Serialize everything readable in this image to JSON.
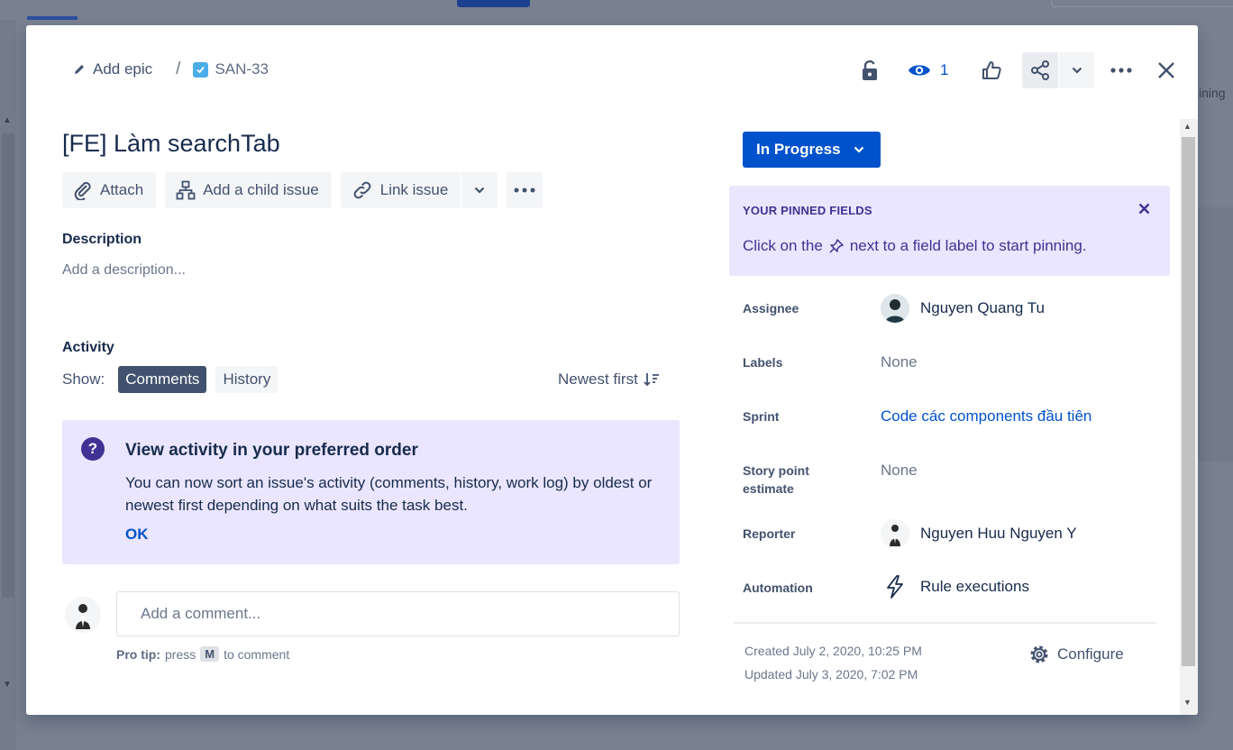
{
  "breadcrumb": {
    "add_epic": "Add epic",
    "separator": "/",
    "issue_key": "SAN-33"
  },
  "toolbar": {
    "watch_count": "1"
  },
  "issue": {
    "title": "[FE] Làm searchTab"
  },
  "actions": {
    "attach": "Attach",
    "add_child": "Add a child issue",
    "link_issue": "Link issue"
  },
  "description": {
    "label": "Description",
    "placeholder": "Add a description..."
  },
  "activity": {
    "label": "Activity",
    "show": "Show:",
    "tabs": [
      "Comments",
      "History"
    ],
    "sort": "Newest first",
    "info": {
      "title": "View activity in your preferred order",
      "body": "You can now sort an issue's activity (comments, history, work log) by oldest or newest first depending on what suits the task best.",
      "ok": "OK"
    },
    "comment_placeholder": "Add a comment...",
    "pro_tip_label": "Pro tip:",
    "pro_tip_pre": "press",
    "pro_tip_key": "M",
    "pro_tip_post": "to comment"
  },
  "status": {
    "label": "In Progress"
  },
  "pinned": {
    "title": "YOUR PINNED FIELDS",
    "text_pre": "Click on the",
    "text_post": "next to a field label to start pinning."
  },
  "fields": {
    "assignee": {
      "label": "Assignee",
      "value": "Nguyen Quang Tu"
    },
    "labels": {
      "label": "Labels",
      "value": "None"
    },
    "sprint": {
      "label": "Sprint",
      "value": "Code các components đầu tiên"
    },
    "story_points": {
      "label": "Story point estimate",
      "value": "None"
    },
    "reporter": {
      "label": "Reporter",
      "value": "Nguyen Huu Nguyen Y"
    },
    "automation": {
      "label": "Automation",
      "value": "Rule executions"
    }
  },
  "meta": {
    "created": "Created July 2, 2020, 10:25 PM",
    "updated": "Updated July 3, 2020, 7:02 PM",
    "configure": "Configure"
  },
  "background": {
    "right_text": "ining"
  },
  "colors": {
    "primary": "#0052cc",
    "purple_bg": "#eae6ff",
    "purple_text": "#403294",
    "text": "#172b4d",
    "subtle": "#42526e"
  }
}
